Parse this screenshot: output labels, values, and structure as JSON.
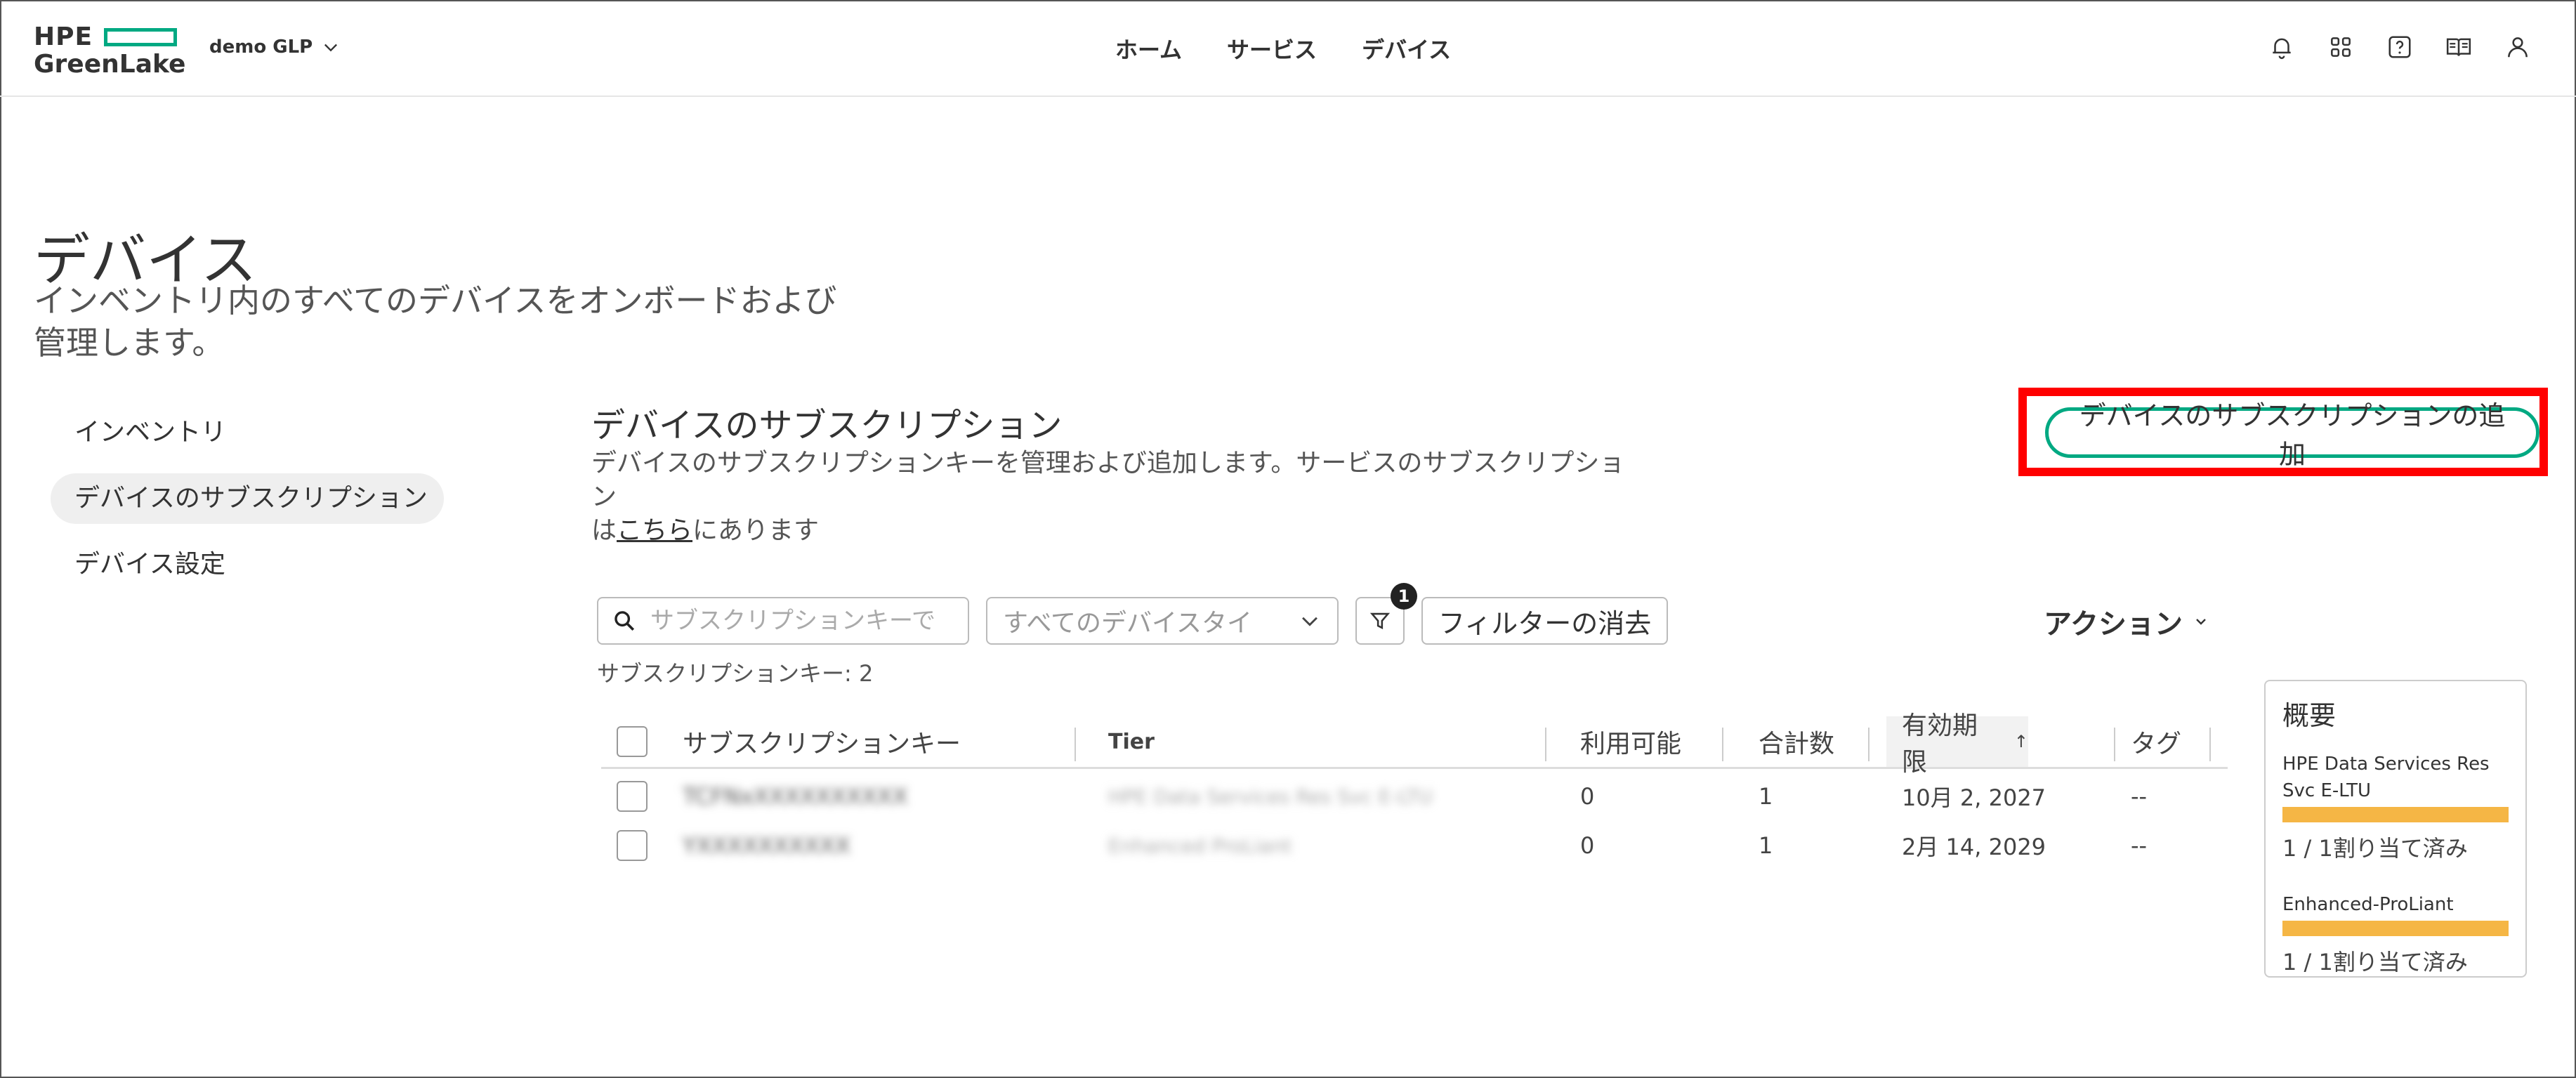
{
  "header": {
    "logo_line1": "HPE",
    "logo_line2": "GreenLake",
    "workspace": "demo GLP",
    "nav": [
      "ホーム",
      "サービス",
      "デバイス"
    ],
    "icons": [
      "bell-icon",
      "apps-grid-icon",
      "help-icon",
      "docs-book-icon",
      "user-icon"
    ]
  },
  "page": {
    "title": "デバイス",
    "description_line1": "インベントリ内のすべてのデバイスをオンボードおよび",
    "description_line2": "管理します。"
  },
  "sidebar": {
    "items": [
      {
        "label": "インベントリ",
        "active": false
      },
      {
        "label": "デバイスのサブスクリプション",
        "active": true
      },
      {
        "label": "デバイス設定",
        "active": false
      }
    ]
  },
  "section": {
    "title": "デバイスのサブスクリプション",
    "desc_part1": "デバイスのサブスクリプションキーを管理および追加します。サービスのサブスクリプション",
    "desc_part2": "は",
    "desc_link": "こちら",
    "desc_part3": "にあります",
    "add_button": "デバイスのサブスクリプションの追加"
  },
  "toolbar": {
    "search_placeholder": "サブスクリプションキーで",
    "device_type_select": "すべてのデバイスタイ",
    "filter_badge": "1",
    "clear_filters": "フィルターの消去",
    "actions": "アクション",
    "count_text": "サブスクリプションキー: 2"
  },
  "table": {
    "columns": [
      "サブスクリプションキー",
      "Tier",
      "利用可能",
      "合計数",
      "有効期限",
      "タグ"
    ],
    "sort_indicator": "↑",
    "rows": [
      {
        "key": "TCFNxXXXXXXXXXX",
        "tier": "HPE Data Services Res Svc E-LTU",
        "available": "0",
        "total": "1",
        "expiry": "10月 2, 2027",
        "tags": "--"
      },
      {
        "key": "YXXXXXXXXXX",
        "tier": "Enhanced ProLiant",
        "available": "0",
        "total": "1",
        "expiry": "2月 14, 2029",
        "tags": "--"
      }
    ]
  },
  "summary": {
    "title": "概要",
    "items": [
      {
        "name": "HPE Data Services Res Svc E-LTU",
        "stat": "1 / 1割り当て済み",
        "assigned_fraction": 1.0
      },
      {
        "name": "Enhanced-ProLiant",
        "stat": "1 / 1割り当て済み",
        "assigned_fraction": 1.0
      }
    ]
  },
  "colors": {
    "brand_green": "#01a982",
    "highlight_red": "#ff0000",
    "bar_orange": "#f5b645"
  }
}
